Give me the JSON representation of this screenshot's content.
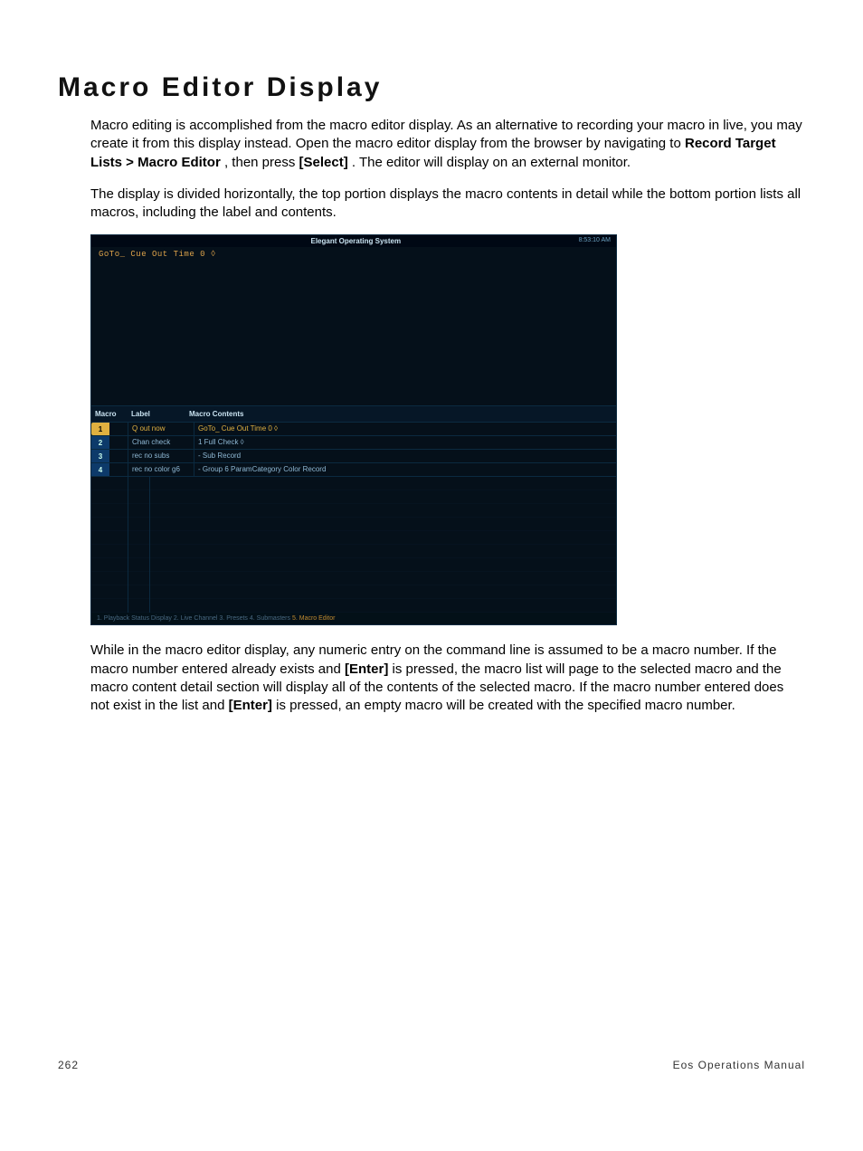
{
  "heading": "Macro Editor Display",
  "para1_a": "Macro editing is accomplished from the macro editor display. As an alternative to recording your macro in live, you may create it from this display instead. Open the macro editor display from the browser by navigating to ",
  "para1_b1": "Record Target Lists > Macro Editor",
  "para1_c": ", then press ",
  "para1_b2": "[Select]",
  "para1_d": ". The editor will display on an external monitor.",
  "para2": "The display is divided horizontally, the top portion displays the macro contents in detail while the bottom portion lists all macros, including the label and contents.",
  "para3_a": "While in the macro editor display, any numeric entry on the command line is assumed to be a macro number. If the macro number entered already exists and ",
  "para3_b1": "[Enter]",
  "para3_b": " is pressed, the macro list will page to the selected macro and the macro content detail section will display all of the contents of the selected macro. If the macro number entered does not exist in the list and ",
  "para3_b2": "[Enter]",
  "para3_c": " is pressed, an empty macro will be created with the specified macro number.",
  "screenshot": {
    "title": "Elegant Operating System",
    "clock": "8:53:10 AM",
    "cmdline": "GoTo_ Cue Out Time 0 ◊",
    "headers": {
      "c1": "Macro",
      "c2": "Label",
      "c3": "Macro Contents"
    },
    "rows": [
      {
        "n": "1",
        "label": "Q out now",
        "contents": "GoTo_ Cue Out Time 0 ◊",
        "sel": true
      },
      {
        "n": "2",
        "label": "Chan check",
        "contents": "1 Full Check ◊",
        "sel": false
      },
      {
        "n": "3",
        "label": "rec no subs",
        "contents": "- Sub Record",
        "sel": false
      },
      {
        "n": "4",
        "label": "rec no color g6",
        "contents": "- Group 6 ParamCategory Color Record",
        "sel": false
      }
    ],
    "tabs": "1. Playback Status Display    2. Live Channel    3. Presets    4. Submasters    ",
    "tab_active": "5. Macro Editor"
  },
  "footer": {
    "page": "262",
    "title": "Eos Operations Manual"
  }
}
